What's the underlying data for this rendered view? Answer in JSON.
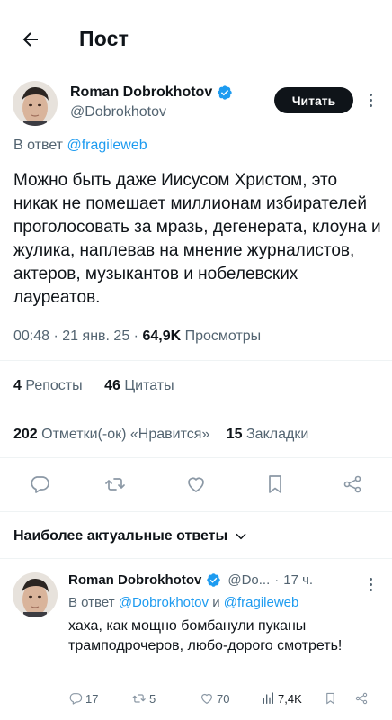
{
  "header": {
    "title": "Пост"
  },
  "tweet": {
    "author_name": "Roman Dobrokhotov",
    "handle": "@Dobrokhotov",
    "read_label": "Читать",
    "reply_prefix": "В ответ",
    "reply_mention": "@fragileweb",
    "text": "Можно быть даже Иисусом Христом, это никак не помешает миллионам избирателей проголосовать за  мразь, дегенерата, клоуна и жулика, наплевав на мнение журналистов, актеров, музыкантов и нобелевских лауреатов.",
    "time": "00:48",
    "date": "21 янв. 25",
    "views_count": "64,9K",
    "views_label": "Просмотры",
    "reposts_count": "4",
    "reposts_label": "Репосты",
    "quotes_count": "46",
    "quotes_label": "Цитаты",
    "likes_count": "202",
    "likes_label": "Отметки(-ок) «Нравится»",
    "bookmarks_count": "15",
    "bookmarks_label": "Закладки"
  },
  "section": {
    "relevant_label": "Наиболее актуальные ответы"
  },
  "reply": {
    "author_name": "Roman Dobrokhotov",
    "handle": "@Do...",
    "time": "17 ч.",
    "reply_prefix": "В ответ",
    "mention_1": "@Dobrokhotov",
    "and_word": "и",
    "mention_2": "@fragileweb",
    "text": "хаха, как мощно бомбанули пуканы трамподрочеров, любо-дорого смотреть!",
    "comments": "17",
    "reposts": "5",
    "likes": "70",
    "views": "7,4K"
  },
  "colors": {
    "accent": "#1d9bf0",
    "muted": "#536471",
    "text": "#0f1419",
    "verified": "#1d9bf0"
  }
}
